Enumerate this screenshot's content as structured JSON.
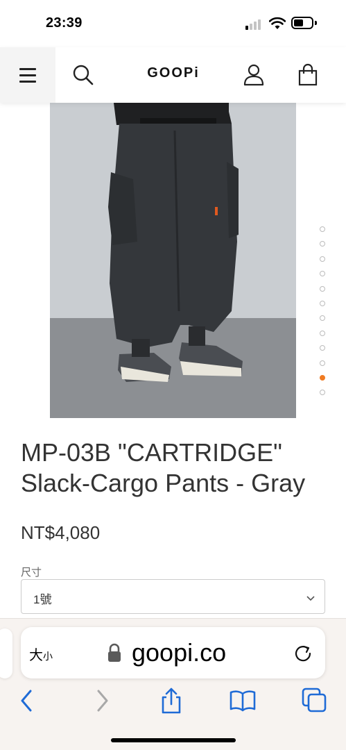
{
  "status_bar": {
    "time": "23:39"
  },
  "header": {
    "logo": "GOOPi",
    "icons": [
      "menu-icon",
      "search-icon",
      "account-icon",
      "cart-icon"
    ]
  },
  "product": {
    "title_line1": "MP-03B \"CARTRIDGE\"",
    "title_line2": "Slack-Cargo Pants - Gray",
    "price": "NT$4,080",
    "size_label": "尺寸",
    "size_value": "1號",
    "carousel": {
      "total_images": 12,
      "active_index": 10,
      "active_color": "#f07b22"
    }
  },
  "browser": {
    "reader_label_large": "大",
    "reader_label_small": "小",
    "url": "goopi.co",
    "toolbar_icons": [
      "back-icon",
      "forward-icon",
      "share-icon",
      "bookmarks-icon",
      "tabs-icon"
    ],
    "accent_color": "#1f6bd6"
  }
}
